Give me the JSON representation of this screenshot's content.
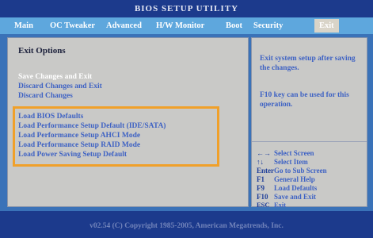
{
  "window": {
    "title": "BIOS SETUP UTILITY"
  },
  "menu": {
    "items": [
      "Main",
      "OC Tweaker",
      "Advanced",
      "H/W Monitor",
      "Boot",
      "Security",
      "Exit"
    ]
  },
  "exit_panel": {
    "title": "Exit Options",
    "options": [
      "Save Changes and Exit",
      "Discard Changes and Exit",
      "Discard Changes",
      "Load BIOS Defaults",
      "Load Performance Setup Default (IDE/SATA)",
      "Load Performance Setup AHCI Mode",
      "Load Performance Setup RAID Mode",
      "Load Power Saving Setup Default"
    ]
  },
  "help": {
    "description": "Exit system setup after saving the changes.",
    "hint": "F10 key can be used for this operation.",
    "keys": [
      {
        "key": "←→",
        "desc": "Select Screen"
      },
      {
        "key": "↑↓",
        "desc": "Select Item"
      },
      {
        "key": "Enter",
        "desc": "Go to Sub Screen"
      },
      {
        "key": "F1",
        "desc": "General Help"
      },
      {
        "key": "F9",
        "desc": "Load Defaults"
      },
      {
        "key": "F10",
        "desc": "Save and Exit"
      },
      {
        "key": "ESC",
        "desc": "Exit"
      }
    ]
  },
  "footer": {
    "text": "v02.54 (C) Copyright 1985-2005, American Megatrends, Inc."
  },
  "colors": {
    "background": "#18347f",
    "menubar": "#5ea7dd",
    "panel": "#c9c9c7",
    "option_text": "#3e62c4",
    "highlight_border": "#f0a02a"
  }
}
